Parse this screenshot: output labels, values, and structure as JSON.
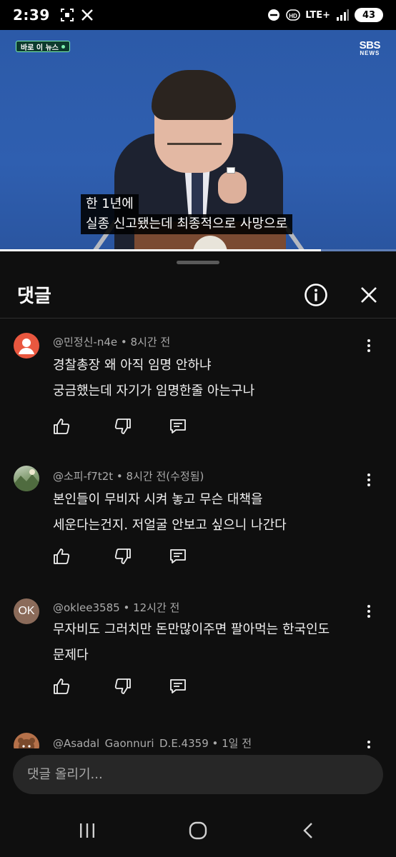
{
  "status_bar": {
    "time": "2:39",
    "network": "LTE+",
    "battery": "43",
    "icons": [
      "screenshot-icon",
      "x-app-icon",
      "dnd-icon",
      "hd-icon",
      "signal-icon",
      "battery-icon"
    ]
  },
  "video": {
    "live_badge": "바로 이 뉴스",
    "logo_top": "SBS",
    "logo_bottom": "NEWS",
    "subtitle_line1": "한 1년에",
    "subtitle_line2": "실종 신고됐는데 최종적으로 사망으로",
    "progress": 0.81
  },
  "sheet": {
    "title": "댓글",
    "info_icon": "info-icon",
    "close_icon": "close-icon"
  },
  "comments": [
    {
      "author": "@민정신-n4e",
      "time": "8시간 전",
      "text_lines": [
        "경찰총장  왜 아직 임명 안하냐",
        "궁금했는데 자기가 임명한줄 아는구나"
      ],
      "avatar_kind": "default",
      "avatar_color": "#e9573f"
    },
    {
      "author": "@소피-f7t2t",
      "time": "8시간 전(수정됨)",
      "text_lines": [
        "본인들이 무비자 시켜 놓고 무슨 대책을",
        "세운다는건지. 저얼굴 안보고 싶으니 나간다"
      ],
      "avatar_kind": "photo",
      "avatar_color": "#8aa37a"
    },
    {
      "author": "@oklee3585",
      "time": "12시간 전",
      "text_lines": [
        "무자비도 그러치만 돈만많이주면 팔아먹는 한국인도",
        "문제다"
      ],
      "avatar_kind": "initials",
      "avatar_initials": "OK",
      "avatar_color": "#8b6b5a"
    },
    {
      "author": "@Asadal_Gaonnuri_D.E.4359",
      "time": "1일 전",
      "text_lines": [],
      "avatar_kind": "photo",
      "avatar_color": "#b5714a"
    }
  ],
  "input": {
    "placeholder": "댓글 올리기..."
  },
  "navbar": {
    "recents_icon": "recents-icon",
    "home_icon": "home-icon",
    "back_icon": "back-icon"
  }
}
